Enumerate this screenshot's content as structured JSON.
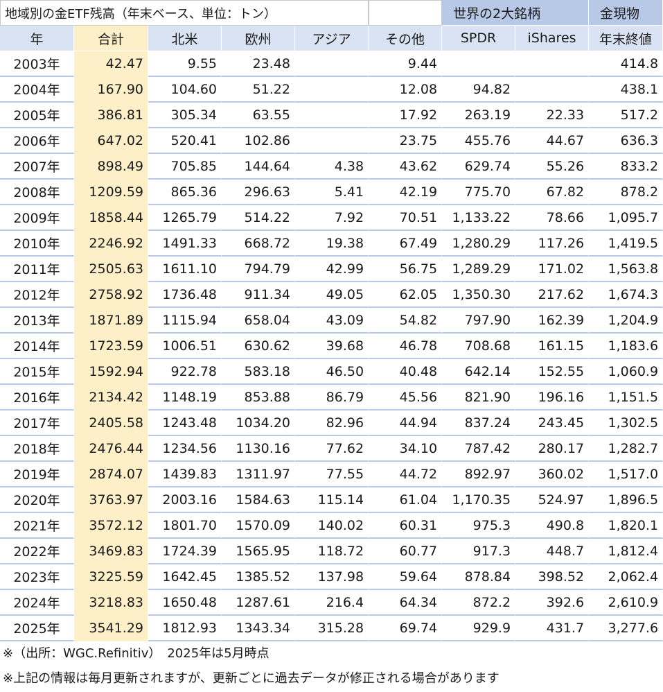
{
  "table": {
    "title": "地域別の金ETF残高（年末ベース、単位：トン）",
    "group_etf": "世界の2大銘柄",
    "group_gold": "金現物",
    "columns": [
      "年",
      "合計",
      "北米",
      "欧州",
      "アジア",
      "その他",
      "SPDR",
      "iShares",
      "年末終値"
    ],
    "rows": [
      [
        "2003年",
        "42.47",
        "9.55",
        "23.48",
        "",
        "9.44",
        "",
        "",
        "414.8"
      ],
      [
        "2004年",
        "167.90",
        "104.60",
        "51.22",
        "",
        "12.08",
        "94.82",
        "",
        "438.1"
      ],
      [
        "2005年",
        "386.81",
        "305.34",
        "63.55",
        "",
        "17.92",
        "263.19",
        "22.33",
        "517.2"
      ],
      [
        "2006年",
        "647.02",
        "520.41",
        "102.86",
        "",
        "23.75",
        "455.76",
        "44.67",
        "636.3"
      ],
      [
        "2007年",
        "898.49",
        "705.85",
        "144.64",
        "4.38",
        "43.62",
        "629.74",
        "55.26",
        "833.2"
      ],
      [
        "2008年",
        "1209.59",
        "865.36",
        "296.63",
        "5.41",
        "42.19",
        "775.70",
        "67.82",
        "878.2"
      ],
      [
        "2009年",
        "1858.44",
        "1265.79",
        "514.22",
        "7.92",
        "70.51",
        "1,133.22",
        "78.66",
        "1,095.7"
      ],
      [
        "2010年",
        "2246.92",
        "1491.33",
        "668.72",
        "19.38",
        "67.49",
        "1,280.29",
        "117.26",
        "1,419.5"
      ],
      [
        "2011年",
        "2505.63",
        "1611.10",
        "794.79",
        "42.99",
        "56.75",
        "1,289.29",
        "171.02",
        "1,563.8"
      ],
      [
        "2012年",
        "2758.92",
        "1736.48",
        "911.34",
        "49.05",
        "62.05",
        "1,350.30",
        "217.62",
        "1,674.3"
      ],
      [
        "2013年",
        "1871.89",
        "1115.94",
        "658.04",
        "43.09",
        "54.82",
        "797.90",
        "162.39",
        "1,204.9"
      ],
      [
        "2014年",
        "1723.59",
        "1006.51",
        "630.62",
        "39.68",
        "46.78",
        "708.68",
        "161.15",
        "1,183.6"
      ],
      [
        "2015年",
        "1592.94",
        "922.78",
        "583.18",
        "46.50",
        "40.48",
        "642.14",
        "152.55",
        "1,060.9"
      ],
      [
        "2016年",
        "2134.42",
        "1148.19",
        "853.88",
        "86.79",
        "45.56",
        "821.90",
        "196.16",
        "1,151.5"
      ],
      [
        "2017年",
        "2405.58",
        "1243.48",
        "1034.20",
        "82.96",
        "44.94",
        "837.24",
        "243.45",
        "1,302.5"
      ],
      [
        "2018年",
        "2476.44",
        "1234.56",
        "1130.16",
        "77.62",
        "34.10",
        "787.42",
        "280.17",
        "1,282.7"
      ],
      [
        "2019年",
        "2874.07",
        "1439.83",
        "1311.97",
        "77.55",
        "44.72",
        "892.97",
        "360.02",
        "1,517.0"
      ],
      [
        "2020年",
        "3763.97",
        "2003.16",
        "1584.63",
        "115.14",
        "61.04",
        "1,170.35",
        "524.97",
        "1,896.5"
      ],
      [
        "2021年",
        "3572.12",
        "1801.70",
        "1570.09",
        "140.02",
        "60.31",
        "975.3",
        "490.8",
        "1,820.1"
      ],
      [
        "2022年",
        "3469.83",
        "1724.39",
        "1565.95",
        "118.72",
        "60.77",
        "917.3",
        "448.7",
        "1,812.4"
      ],
      [
        "2023年",
        "3225.59",
        "1642.45",
        "1385.52",
        "137.98",
        "59.64",
        "878.84",
        "398.52",
        "2,062.4"
      ],
      [
        "2024年",
        "3218.83",
        "1650.48",
        "1287.61",
        "216.4",
        "64.34",
        "872.2",
        "392.6",
        "2,610.9"
      ],
      [
        "2025年",
        "3541.29",
        "1812.93",
        "1343.34",
        "315.28",
        "69.74",
        "929.9",
        "431.7",
        "3,277.6"
      ]
    ]
  },
  "notes": {
    "source": "※（出所：WGC.Refinitiv）　2025年は5月時点",
    "disclaimer": "※上記の情報は毎月更新されますが、更新ごとに過去データが修正される場合があります"
  },
  "colors": {
    "header_blue": "#dae3f3",
    "group_blue": "#b7c9e6",
    "total_yellow": "#fdf0c8"
  }
}
